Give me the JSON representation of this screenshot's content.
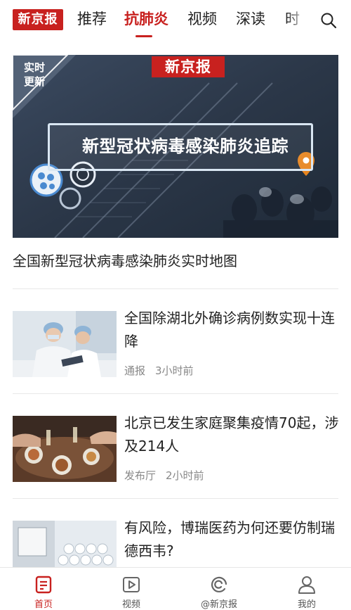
{
  "brand": {
    "logo_text": "新京报",
    "accent_color": "#c8211f"
  },
  "topnav": {
    "tabs": [
      {
        "label": "推荐",
        "active": false
      },
      {
        "label": "抗肺炎",
        "active": true
      },
      {
        "label": "视频",
        "active": false
      },
      {
        "label": "深读",
        "active": false
      },
      {
        "label": "时",
        "active": false
      }
    ],
    "search_icon": "search-icon"
  },
  "banner": {
    "logo_text": "新京报",
    "realtime_badge_line1": "实时",
    "realtime_badge_line2": "更新",
    "heading": "新型冠状病毒感染肺炎追踪",
    "caption": "全国新型冠状病毒感染肺炎实时地图"
  },
  "news": [
    {
      "title": "全国除湖北外确诊病例数实现十连降",
      "source": "通报",
      "time": "3小时前",
      "thumb_icon": "doctors-photo"
    },
    {
      "title": "北京已发生家庭聚集疫情70起，涉及214人",
      "source": "发布厅",
      "time": "2小时前",
      "thumb_icon": "family-dinner-photo"
    },
    {
      "title": "有风险，博瑞医药为何还要仿制瑞德西韦?",
      "source": "",
      "time": "",
      "thumb_icon": "medicine-bottles-photo"
    }
  ],
  "bottombar": {
    "items": [
      {
        "label": "首页",
        "icon": "home-icon",
        "active": true
      },
      {
        "label": "视频",
        "icon": "video-icon",
        "active": false
      },
      {
        "label": "@新京报",
        "icon": "at-icon",
        "active": false
      },
      {
        "label": "我的",
        "icon": "profile-icon",
        "active": false
      }
    ]
  }
}
